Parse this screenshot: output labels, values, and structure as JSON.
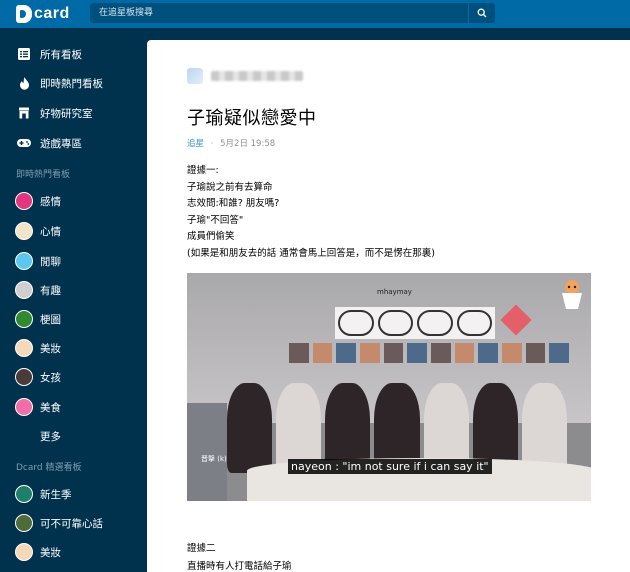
{
  "header": {
    "logo_text": "card",
    "search_placeholder": "在追星板搜尋"
  },
  "sidebar": {
    "main_items": [
      {
        "label": "所有看板",
        "icon": "list-icon"
      },
      {
        "label": "即時熱門看板",
        "icon": "flame-icon"
      },
      {
        "label": "好物研究室",
        "icon": "store-icon"
      },
      {
        "label": "遊戲專區",
        "icon": "gamepad-icon"
      }
    ],
    "hot_section_title": "即時熱門看板",
    "hot_boards": [
      {
        "label": "感情",
        "color": "#e2377e"
      },
      {
        "label": "心情",
        "color": "#f3e3c9"
      },
      {
        "label": "閒聊",
        "color": "#5bc7ee"
      },
      {
        "label": "有趣",
        "color": "#cfcfcf"
      },
      {
        "label": "梗圖",
        "color": "#2f8a2f"
      },
      {
        "label": "美妝",
        "color": "#f6d9b8"
      },
      {
        "label": "女孩",
        "color": "#4a3a3a"
      },
      {
        "label": "美食",
        "color": "#f06ea8"
      }
    ],
    "more_label": "更多",
    "featured_section_title": "Dcard 精選看板",
    "featured_boards": [
      {
        "label": "新生季",
        "color": "#1f7f6b"
      },
      {
        "label": "可不可靠心話",
        "color": "#4e6b3a"
      },
      {
        "label": "美妝",
        "color": "#f6d9b8"
      }
    ]
  },
  "post": {
    "title": "子瑜疑似戀愛中",
    "board": "追星",
    "separator": "·",
    "date": "5月2日 19:58",
    "lines": [
      "證據一:",
      "子瑜說之前有去算命",
      "志效問:和誰? 朋友嗎?",
      "子瑜\"不回答\"",
      "成員們偷笑",
      "(如果是和朋友去的話 通常會馬上回答是，而不是愣在那裏)"
    ],
    "video": {
      "watermark": "mhaymay",
      "cast_name": "晋撃 (k)",
      "caption": "nayeon : \"im not sure if i can say it\""
    },
    "lines2": [
      "證據二",
      "直播時有人打電話給子瑜"
    ]
  }
}
